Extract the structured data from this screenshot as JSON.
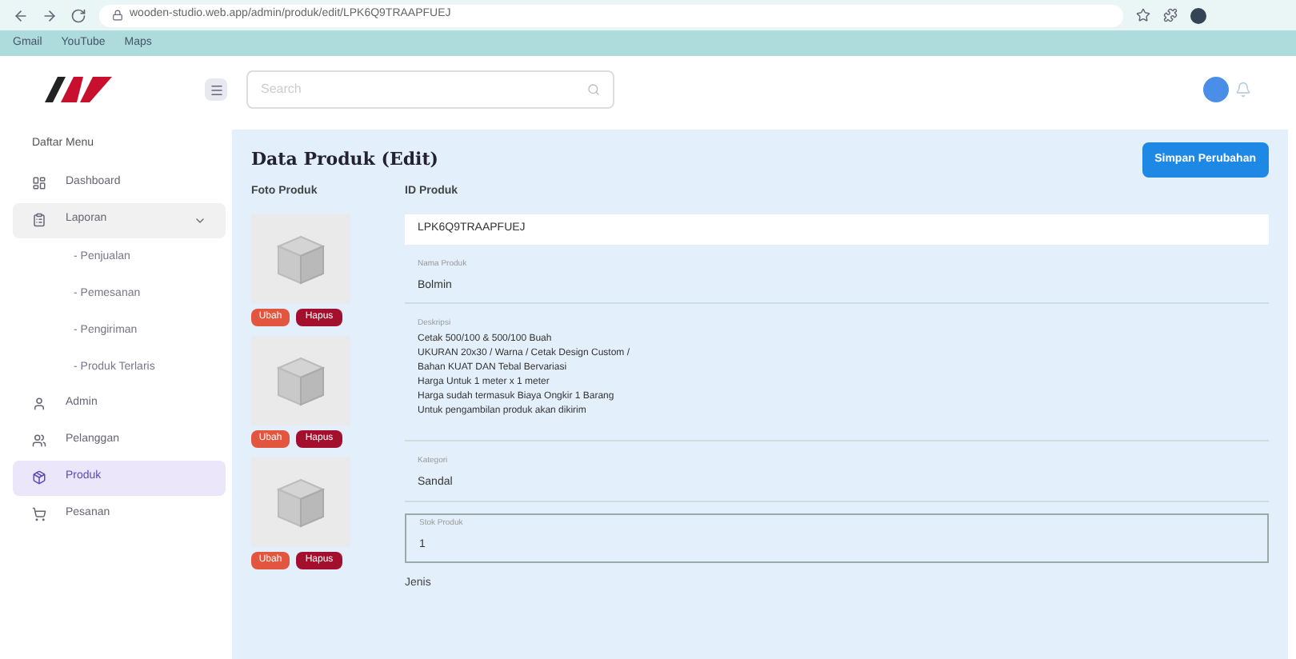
{
  "browser": {
    "url": "wooden-studio.web.app/admin/produk/edit/LPK6Q9TRAAPFUEJ",
    "bookmarks": [
      {
        "label": "Gmail"
      },
      {
        "label": "YouTube"
      },
      {
        "label": "Maps"
      }
    ]
  },
  "header": {
    "search": {
      "placeholder": "Search"
    }
  },
  "sidebar": {
    "title": "Daftar Menu",
    "items": [
      {
        "label": "Dashboard",
        "selected": false
      },
      {
        "label": "Laporan",
        "selected": false,
        "expanded": true,
        "children": [
          {
            "label": "- Penjualan"
          },
          {
            "label": "- Pemesanan"
          },
          {
            "label": "- Pengiriman"
          },
          {
            "label": "- Produk Terlaris"
          }
        ]
      },
      {
        "label": "Admin",
        "selected": false
      },
      {
        "label": "Pelanggan",
        "selected": false
      },
      {
        "label": "Produk",
        "selected": true
      },
      {
        "label": "Pesanan",
        "selected": false
      }
    ]
  },
  "content": {
    "title": "Data Produk (Edit)",
    "save_button": "Simpan Perubahan",
    "photos_label": "Foto Produk",
    "photos": [
      {
        "edit": "Ubah",
        "delete": "Hapus"
      },
      {
        "edit": "Ubah",
        "delete": "Hapus"
      },
      {
        "edit": "Ubah",
        "delete": "Hapus"
      }
    ],
    "id_label": "ID Produk",
    "id_value": "LPK6Q9TRAAPFUEJ",
    "fields": [
      {
        "kind": "text",
        "label": "Nama Produk",
        "value": "Bolmin",
        "focused": false
      },
      {
        "kind": "multiline",
        "label": "Deskripsi",
        "value": "Cetak 500/100 & 500/100 Buah\nUKURAN 20x30 / Warna / Cetak Design Custom /\nBahan KUAT DAN Tebal Bervariasi\nHarga Untuk 1 meter x 1 meter\nHarga sudah termasuk Biaya Ongkir 1 Barang\nUntuk pengambilan produk akan dikirim",
        "focused": false
      },
      {
        "kind": "text",
        "label": "Kategori",
        "value": "Sandal",
        "focused": false
      },
      {
        "kind": "text",
        "label": "Stok Produk",
        "value": "1",
        "focused": true
      }
    ],
    "next_label": "Jenis"
  }
}
